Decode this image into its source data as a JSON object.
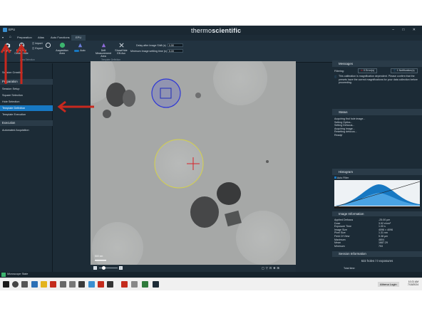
{
  "window": {
    "title": "EPU",
    "brand_light": "thermo",
    "brand_bold": "scientific",
    "controls": "– □ ✕"
  },
  "menu": [
    "Preparation",
    "Atlas",
    "Auto Functions",
    "EPU"
  ],
  "ribbon": {
    "acquire": "Acquire",
    "find_center": "Find And Center Hole",
    "import": "Import",
    "export": "Export",
    "acquisition_area": "Acquisition Area",
    "auto": "Auto",
    "drift": "Drift Measurement Area",
    "showhide": "Show/Hide GN Acc",
    "delay_label": "Delay after Image Shift (s)",
    "delay_value": "0.50",
    "settle_label": "Minimum Image settling time (s)",
    "settle_value": "5.00",
    "group_label": "Template Definition",
    "group_label2": "Area Selection"
  },
  "left_panel": {
    "items_top": [
      "Session Creation"
    ],
    "preparation_head": "Preparation",
    "prep_items": [
      "Session Setup",
      "Square Selection",
      "Hole Selection",
      "Template Definition",
      "Template Execution"
    ],
    "selected": "Template Definition",
    "execution_head": "Execution",
    "exec_items": [
      "Automated Acquisition"
    ]
  },
  "viewer": {
    "scalebar": "500 nm"
  },
  "messages": {
    "title": "Messages",
    "filtering": "Filtering:",
    "errors": "0 Error(s)",
    "notifications": "1 Notification(s)",
    "text": "This calibration is magnification dependent. Please confirm that the presets have the correct magnifications for your data collection before proceeding."
  },
  "status": {
    "title": "Status",
    "lines": [
      "Acquiring find hole image...",
      "Setting Optics...",
      "Setting Defocus...",
      "Acquiring image...",
      "Resetting defocus...",
      "Ready!"
    ]
  },
  "histogram": {
    "title": "Histogram",
    "auto_filter": "Auto Filter"
  },
  "image_info": {
    "title": "Image Information",
    "rows": [
      [
        "Applied Defocus",
        "-25.00 µm"
      ],
      [
        "Dose",
        "3.92 e/nm²"
      ],
      [
        "Exposure Time",
        "1.00 s"
      ],
      [
        "Image Size",
        "4096 × 4096"
      ],
      [
        "Pixel Size",
        "1.31 nm"
      ],
      [
        "Field Of View",
        "5.38 µm"
      ],
      [
        "Maximum",
        "4804"
      ],
      [
        "Mean",
        "1687.29"
      ],
      [
        "Minimum",
        "753"
      ]
    ]
  },
  "session": {
    "title": "Session Information",
    "holes": "622 holes / 0 exposures",
    "total_time": "Total time:"
  },
  "statusbar": {
    "microscope": "Microscope State"
  },
  "taskbar": {
    "athena": "Athena Login",
    "time": "10:21 AM",
    "date": "7/18/2024"
  },
  "colors": {
    "accent": "#1778c2",
    "arrow": "#c8281e"
  }
}
